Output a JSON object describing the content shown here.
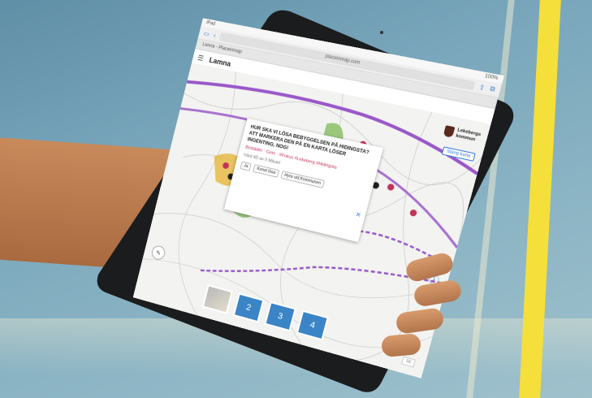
{
  "browser": {
    "url": "placeinmap.com",
    "tabs": [
      "Lenna - Placeinmap"
    ],
    "app_title": "Lamna"
  },
  "municipality": {
    "name": "Lekebergs\nkommun"
  },
  "map": {
    "hide_button_label": "Stäng karta",
    "popup": {
      "question": "Hur ska vi lösa bebyggelsen på Hidingsta? Att markera den på en karta löser ingenting, nog!",
      "tags": "Bostäder · Grön · #Fokus #Lekeberg #Hidingsta",
      "meta": "Värd 4D av 0 Mikael",
      "buttons": [
        "Ja",
        "Konst lösa",
        "Hyra vid Kommunen"
      ]
    }
  },
  "tiles": [
    "2",
    "3",
    "4"
  ],
  "colors": {
    "accent": "#3b84c6",
    "route": "#9a58c9",
    "pin": "#c0335a",
    "green": "#8cbf6a",
    "yellow": "#e6b63c"
  },
  "icons": [
    "close-icon",
    "info-icon",
    "zoom-in-icon",
    "zoom-out-icon",
    "menu-icon",
    "share-icon",
    "tabs-icon"
  ]
}
